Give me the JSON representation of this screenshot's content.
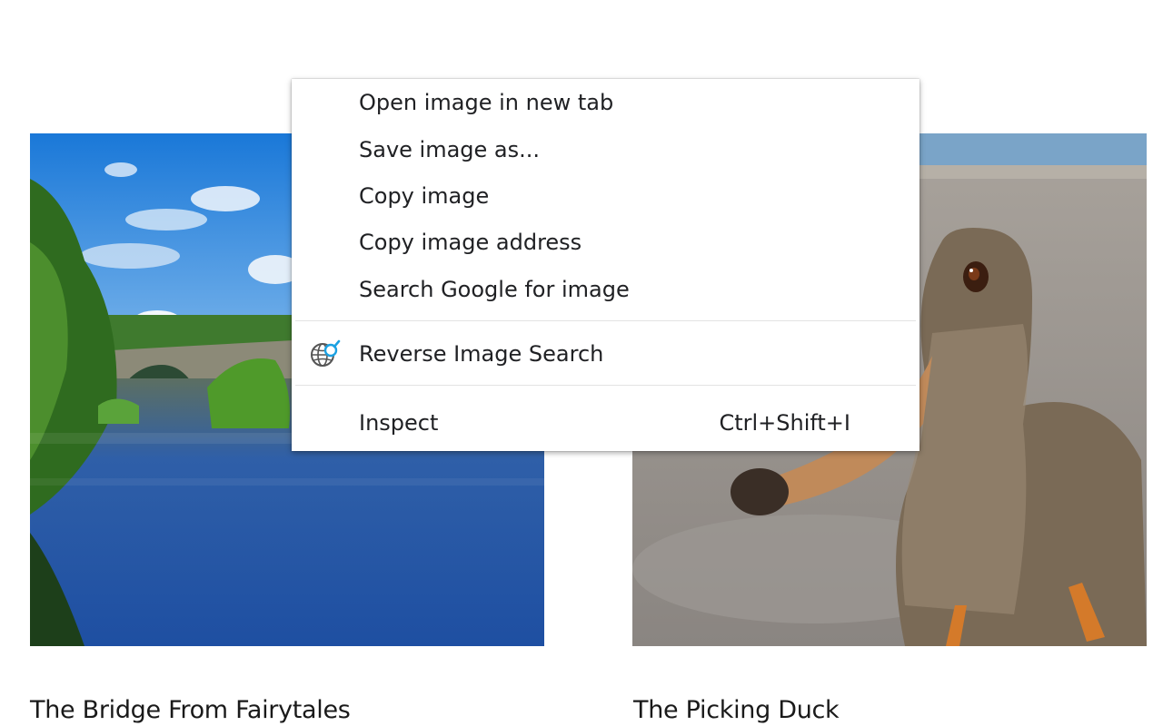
{
  "cards": [
    {
      "title": "The Bridge From Fairytales"
    },
    {
      "title": "The Picking Duck"
    }
  ],
  "context_menu": {
    "items": [
      {
        "label": "Open image in new tab"
      },
      {
        "label": "Save image as..."
      },
      {
        "label": "Copy image"
      },
      {
        "label": "Copy image address"
      },
      {
        "label": "Search Google for image"
      },
      {
        "label": "Reverse Image Search",
        "icon": "globe-search-icon"
      },
      {
        "label": "Inspect",
        "shortcut": "Ctrl+Shift+I"
      }
    ]
  },
  "colors": {
    "menu_bg": "#ffffff",
    "separator": "#e3e3e3",
    "icon_accent": "#1ba1e2"
  }
}
